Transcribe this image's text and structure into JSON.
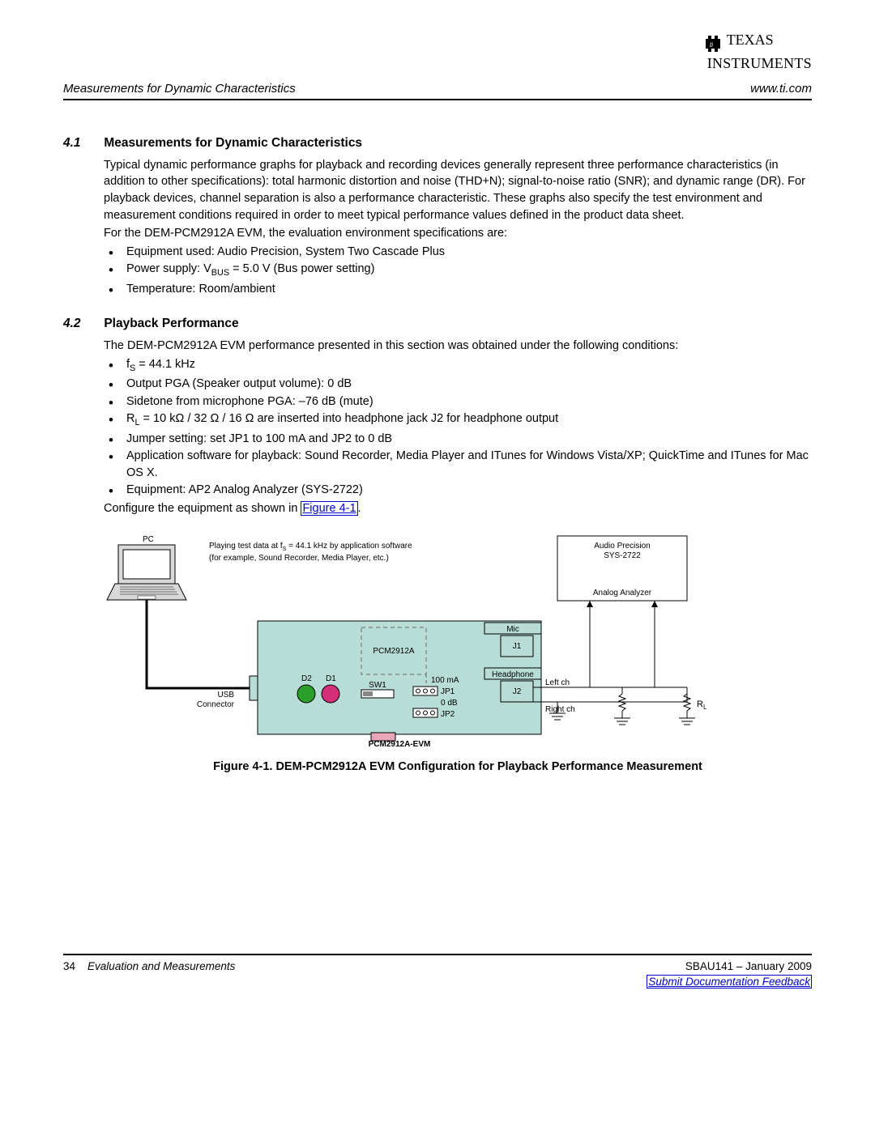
{
  "logo": {
    "line1": "TEXAS",
    "line2": "INSTRUMENTS"
  },
  "header": {
    "left": "Measurements for Dynamic Characteristics",
    "right": "www.ti.com"
  },
  "sec41": {
    "num": "4.1",
    "title": "Measurements for Dynamic Characteristics",
    "para1": "Typical dynamic performance graphs for playback and recording devices generally represent three performance characteristics (in addition to other specifications): total harmonic distortion and noise (THD+N); signal-to-noise ratio (SNR); and dynamic range (DR). For playback devices, channel separation is also a performance characteristic. These graphs also specify the test environment and measurement conditions required in order to meet typical performance values defined in the product data sheet.",
    "para2": "For the DEM-PCM2912A EVM, the evaluation environment specifications are:",
    "bullets": [
      "Equipment used: Audio Precision, System Two Cascade Plus",
      "Power supply: V<sub class=\"sub\">BUS</sub> = 5.0 V (Bus power setting)",
      "Temperature: Room/ambient"
    ]
  },
  "sec42": {
    "num": "4.2",
    "title": "Playback Performance",
    "para1": "The DEM-PCM2912A EVM performance presented in this section was obtained under the following conditions:",
    "bullets": [
      "f<sub class=\"sub\">S</sub> = 44.1 kHz",
      "Output PGA (Speaker output volume): 0 dB",
      "Sidetone from microphone PGA: –76 dB (mute)",
      "R<sub class=\"sub\">L</sub> = 10 kΩ / 32 Ω / 16 Ω are inserted into headphone jack J2 for headphone output",
      "Jumper setting: set JP1 to 100 mA and JP2 to 0 dB",
      "Application software for playback: Sound Recorder, Media Player and ITunes for Windows Vista/XP; QuickTime and ITunes for Mac OS X.",
      "Equipment: AP2 Analog Analyzer (SYS-2722)"
    ],
    "config_pre": "Configure the equipment as shown in ",
    "config_link": "Figure 4-1",
    "config_post": "."
  },
  "figure": {
    "caption": "Figure 4-1. DEM-PCM2912A EVM Configuration for Playback Performance Measurement",
    "labels": {
      "pc": "PC",
      "play_line1": "Playing test data at f",
      "play_s": "S",
      "play_line1b": " = 44.1 kHz by application software",
      "play_line2": "(for example, Sound Recorder, Media Player, etc.)",
      "ap_line1": "Audio Precision",
      "ap_line2": "SYS-2722",
      "ap_line3": "Analog Analyzer",
      "mic": "Mic",
      "j1": "J1",
      "headphone": "Headphone",
      "j2": "J2",
      "leftch": "Left ch",
      "rightch": "Right ch",
      "d2": "D2",
      "d1": "D1",
      "sw1": "SW1",
      "pcm2912a": "PCM2912A",
      "jp1": "JP1",
      "jp2": "JP2",
      "ma100": "100 mA",
      "db0": "0 dB",
      "usb1": "USB",
      "usb2": "Connector",
      "evm": "PCM2912A-EVM",
      "rl": "R",
      "rl_sub": "L"
    }
  },
  "footer": {
    "page": "34",
    "chapter": "Evaluation and Measurements",
    "docid": "SBAU141 – January 2009",
    "feedback": "Submit Documentation Feedback"
  }
}
